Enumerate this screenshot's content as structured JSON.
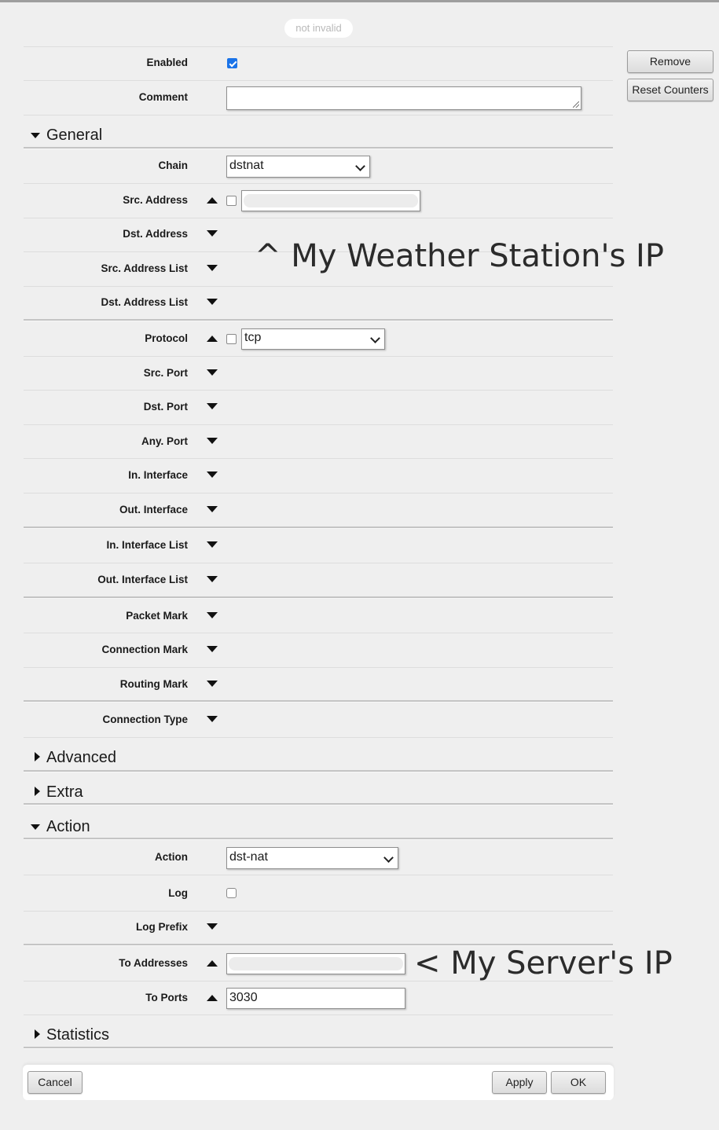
{
  "status_badge": "not invalid",
  "side_buttons": {
    "remove": "Remove",
    "reset_counters": "Reset Counters"
  },
  "top_fields": {
    "enabled": {
      "label": "Enabled",
      "checked": true
    },
    "comment": {
      "label": "Comment",
      "value": ""
    }
  },
  "sections": {
    "general": {
      "label": "General",
      "expanded": true
    },
    "advanced": {
      "label": "Advanced",
      "expanded": false
    },
    "extra": {
      "label": "Extra",
      "expanded": false
    },
    "action": {
      "label": "Action",
      "expanded": true
    },
    "statistics": {
      "label": "Statistics",
      "expanded": false
    }
  },
  "general": {
    "chain": {
      "label": "Chain",
      "value": "dstnat"
    },
    "src_address": {
      "label": "Src. Address",
      "value": "[redacted]",
      "negate": false
    },
    "dst_address": {
      "label": "Dst. Address"
    },
    "src_address_list": {
      "label": "Src. Address List"
    },
    "dst_address_list": {
      "label": "Dst. Address List"
    },
    "protocol": {
      "label": "Protocol",
      "value": "tcp",
      "negate": false
    },
    "src_port": {
      "label": "Src. Port"
    },
    "dst_port": {
      "label": "Dst. Port"
    },
    "any_port": {
      "label": "Any. Port"
    },
    "in_interface": {
      "label": "In. Interface"
    },
    "out_interface": {
      "label": "Out. Interface"
    },
    "in_interface_list": {
      "label": "In. Interface List"
    },
    "out_interface_list": {
      "label": "Out. Interface List"
    },
    "packet_mark": {
      "label": "Packet Mark"
    },
    "connection_mark": {
      "label": "Connection Mark"
    },
    "routing_mark": {
      "label": "Routing Mark"
    },
    "connection_type": {
      "label": "Connection Type"
    }
  },
  "action": {
    "action": {
      "label": "Action",
      "value": "dst-nat"
    },
    "log": {
      "label": "Log",
      "checked": false
    },
    "log_prefix": {
      "label": "Log Prefix"
    },
    "to_addresses": {
      "label": "To Addresses",
      "value": "[redacted]"
    },
    "to_ports": {
      "label": "To Ports",
      "value": "3030"
    }
  },
  "annotations": {
    "weather_station": "^ My Weather Station's IP",
    "server": "< My Server's IP"
  },
  "footer": {
    "cancel": "Cancel",
    "apply": "Apply",
    "ok": "OK"
  },
  "colors": {
    "accent": "#1a73e8",
    "background": "#efefef"
  }
}
